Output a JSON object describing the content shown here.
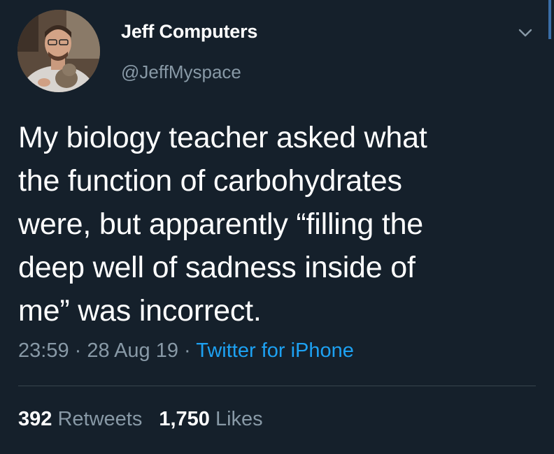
{
  "user": {
    "display_name": "Jeff Computers",
    "handle": "@JeffMyspace"
  },
  "tweet": {
    "lines": [
      "My biology teacher asked what",
      "the function of carbohydrates",
      "were, but apparently “filling the",
      "deep well of sadness inside of",
      "me” was incorrect."
    ],
    "time": "23:59",
    "separator": " · ",
    "date": "28 Aug 19",
    "source": "Twitter for iPhone"
  },
  "stats": {
    "retweets_count": "392",
    "retweets_label": " Retweets",
    "likes_count": "1,750",
    "likes_label": " Likes"
  },
  "icons": {
    "menu": "chevron-down-icon",
    "avatar": "avatar"
  },
  "colors": {
    "background": "#15202b",
    "text": "#ffffff",
    "secondary": "#8899a6",
    "link": "#1da1f2",
    "divider": "#38444d"
  }
}
